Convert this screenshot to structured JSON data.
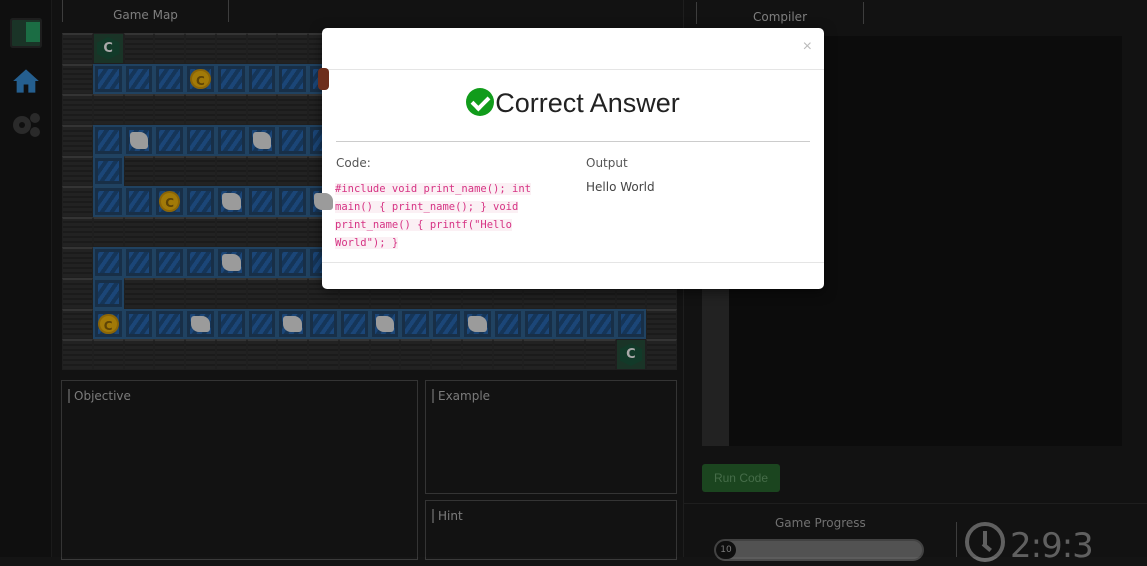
{
  "sidebar": {
    "items": [
      {
        "icon": "logo"
      },
      {
        "icon": "home-icon"
      },
      {
        "icon": "gear-icon"
      }
    ]
  },
  "left": {
    "map_title": "Game Map",
    "objective_label": "Objective",
    "example_label": "Example",
    "hint_label": "Hint"
  },
  "map": {
    "legend": {
      "W": "wall",
      "P": "path",
      "C": "coin",
      "S": "scroll",
      "E": "c-exit",
      "H": "hero"
    },
    "rows": [
      "WEWWWWWWWWWWWWWWWWWW",
      "WPPPCPPPHWWWWWWWWWWW",
      "WWWWWWWWWWWWWWWWWWWW",
      "WPSPPPSPPWWWWWWWWWWW",
      "WPWWWWWWWWWWWWWWWWWW",
      "WPPCPSPPSWWWWWWWWWWW",
      "WWWWWWWWWWWWWWWWWWWW",
      "WPPPPSPPPWWWWWWWWWWW",
      "WPWWWWWWWWWWWWWWWWWW",
      "WCPPSPPSPPSPPSPPPPPW",
      "WWWWWWWWWWWWWWWWWWEW"
    ]
  },
  "right": {
    "compiler_title": "Compiler",
    "run_label": "Run Code",
    "progress_label": "Game Progress",
    "progress_value": "10",
    "progress_percent": 3,
    "timer": "2:9:3"
  },
  "modal": {
    "title": "Correct Answer",
    "code_label": "Code:",
    "output_label": "Output",
    "code": "#include void print_name(); int main() { print_name(); } void print_name() { printf(\"Hello World\"); }",
    "output": "Hello World",
    "close": "×",
    "coin_glyph": "C",
    "exit_glyph": "C"
  },
  "colors": {
    "success": "#119c1b",
    "run_button": "#1f4d23",
    "code_text": "#d63384"
  }
}
